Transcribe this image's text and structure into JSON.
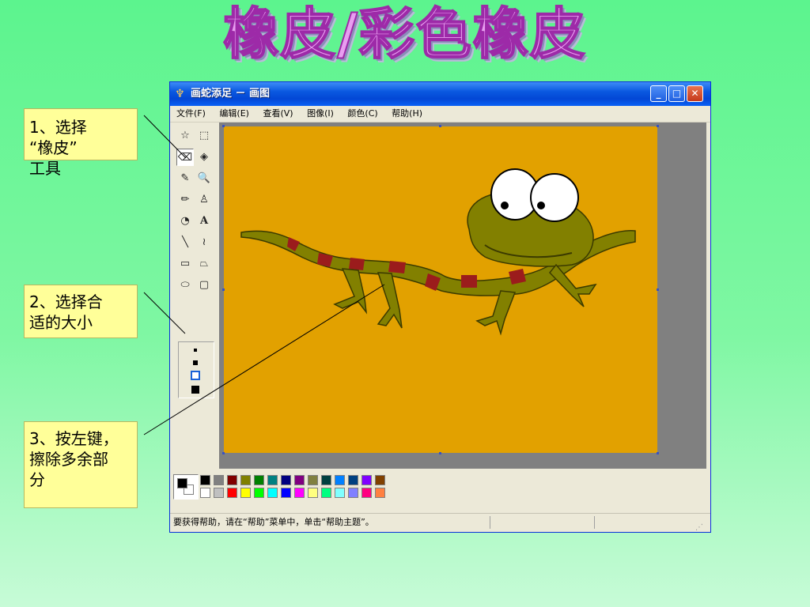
{
  "slide": {
    "title": "橡皮/彩色橡皮",
    "callouts": [
      {
        "line1": "1、选择",
        "line2": "“橡皮”",
        "line3": "工具"
      },
      {
        "line1": "2、选择合",
        "line2": "适的大小"
      },
      {
        "line1": "3、按左键，",
        "line2": "擦除多余部",
        "line3": "分"
      }
    ]
  },
  "window": {
    "title": "画蛇添足 － 画图",
    "app_icon": "paint-brush-icon",
    "controls": {
      "minimize": "minimize-icon",
      "maximize": "maximize-icon",
      "close": "close-icon"
    },
    "menu": [
      "文件(F)",
      "编辑(E)",
      "查看(V)",
      "图像(I)",
      "颜色(C)",
      "帮助(H)"
    ],
    "tools": [
      {
        "name": "free-form-select-icon",
        "glyph": "☆"
      },
      {
        "name": "select-icon",
        "glyph": "⬚"
      },
      {
        "name": "eraser-icon",
        "glyph": "⌫",
        "selected": true
      },
      {
        "name": "fill-bucket-icon",
        "glyph": "◈"
      },
      {
        "name": "pick-color-icon",
        "glyph": "✎"
      },
      {
        "name": "magnifier-icon",
        "glyph": "🔍"
      },
      {
        "name": "pencil-icon",
        "glyph": "✏"
      },
      {
        "name": "brush-icon",
        "glyph": "♙"
      },
      {
        "name": "airbrush-icon",
        "glyph": "◔"
      },
      {
        "name": "text-icon",
        "glyph": "A"
      },
      {
        "name": "line-icon",
        "glyph": "╲"
      },
      {
        "name": "curve-icon",
        "glyph": "≀"
      },
      {
        "name": "rectangle-icon",
        "glyph": "▭"
      },
      {
        "name": "polygon-icon",
        "glyph": "⏢"
      },
      {
        "name": "ellipse-icon",
        "glyph": "⬭"
      },
      {
        "name": "rounded-rectangle-icon",
        "glyph": "▢"
      }
    ],
    "eraser_sizes": [
      "small",
      "medium",
      "large",
      "largest"
    ],
    "selected_eraser_size": "large",
    "palette_top": [
      "#000000",
      "#808080",
      "#800000",
      "#808000",
      "#008000",
      "#008080",
      "#000080",
      "#800080",
      "#808040",
      "#004040",
      "#0080ff",
      "#004080",
      "#8000ff",
      "#804000"
    ],
    "palette_bottom": [
      "#ffffff",
      "#c0c0c0",
      "#ff0000",
      "#ffff00",
      "#00ff00",
      "#00ffff",
      "#0000ff",
      "#ff00ff",
      "#ffff80",
      "#00ff80",
      "#80ffff",
      "#8080ff",
      "#ff0080",
      "#ff8040"
    ],
    "foreground_color": "#000000",
    "background_color": "#ffffff",
    "canvas_color": "#e2a100",
    "status_text": "要获得帮助，请在“帮助”菜单中，单击“帮助主题”。"
  }
}
